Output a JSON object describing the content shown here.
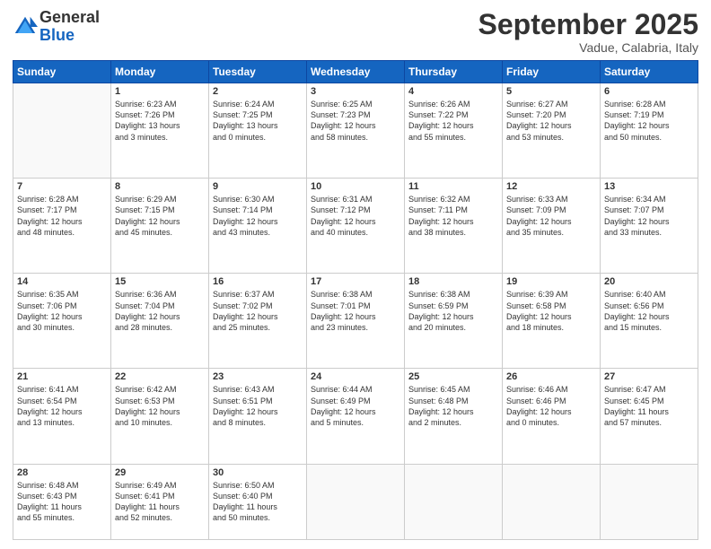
{
  "logo": {
    "general": "General",
    "blue": "Blue"
  },
  "header": {
    "month": "September 2025",
    "location": "Vadue, Calabria, Italy"
  },
  "weekdays": [
    "Sunday",
    "Monday",
    "Tuesday",
    "Wednesday",
    "Thursday",
    "Friday",
    "Saturday"
  ],
  "weeks": [
    [
      {
        "day": "",
        "info": ""
      },
      {
        "day": "1",
        "info": "Sunrise: 6:23 AM\nSunset: 7:26 PM\nDaylight: 13 hours\nand 3 minutes."
      },
      {
        "day": "2",
        "info": "Sunrise: 6:24 AM\nSunset: 7:25 PM\nDaylight: 13 hours\nand 0 minutes."
      },
      {
        "day": "3",
        "info": "Sunrise: 6:25 AM\nSunset: 7:23 PM\nDaylight: 12 hours\nand 58 minutes."
      },
      {
        "day": "4",
        "info": "Sunrise: 6:26 AM\nSunset: 7:22 PM\nDaylight: 12 hours\nand 55 minutes."
      },
      {
        "day": "5",
        "info": "Sunrise: 6:27 AM\nSunset: 7:20 PM\nDaylight: 12 hours\nand 53 minutes."
      },
      {
        "day": "6",
        "info": "Sunrise: 6:28 AM\nSunset: 7:19 PM\nDaylight: 12 hours\nand 50 minutes."
      }
    ],
    [
      {
        "day": "7",
        "info": "Sunrise: 6:28 AM\nSunset: 7:17 PM\nDaylight: 12 hours\nand 48 minutes."
      },
      {
        "day": "8",
        "info": "Sunrise: 6:29 AM\nSunset: 7:15 PM\nDaylight: 12 hours\nand 45 minutes."
      },
      {
        "day": "9",
        "info": "Sunrise: 6:30 AM\nSunset: 7:14 PM\nDaylight: 12 hours\nand 43 minutes."
      },
      {
        "day": "10",
        "info": "Sunrise: 6:31 AM\nSunset: 7:12 PM\nDaylight: 12 hours\nand 40 minutes."
      },
      {
        "day": "11",
        "info": "Sunrise: 6:32 AM\nSunset: 7:11 PM\nDaylight: 12 hours\nand 38 minutes."
      },
      {
        "day": "12",
        "info": "Sunrise: 6:33 AM\nSunset: 7:09 PM\nDaylight: 12 hours\nand 35 minutes."
      },
      {
        "day": "13",
        "info": "Sunrise: 6:34 AM\nSunset: 7:07 PM\nDaylight: 12 hours\nand 33 minutes."
      }
    ],
    [
      {
        "day": "14",
        "info": "Sunrise: 6:35 AM\nSunset: 7:06 PM\nDaylight: 12 hours\nand 30 minutes."
      },
      {
        "day": "15",
        "info": "Sunrise: 6:36 AM\nSunset: 7:04 PM\nDaylight: 12 hours\nand 28 minutes."
      },
      {
        "day": "16",
        "info": "Sunrise: 6:37 AM\nSunset: 7:02 PM\nDaylight: 12 hours\nand 25 minutes."
      },
      {
        "day": "17",
        "info": "Sunrise: 6:38 AM\nSunset: 7:01 PM\nDaylight: 12 hours\nand 23 minutes."
      },
      {
        "day": "18",
        "info": "Sunrise: 6:38 AM\nSunset: 6:59 PM\nDaylight: 12 hours\nand 20 minutes."
      },
      {
        "day": "19",
        "info": "Sunrise: 6:39 AM\nSunset: 6:58 PM\nDaylight: 12 hours\nand 18 minutes."
      },
      {
        "day": "20",
        "info": "Sunrise: 6:40 AM\nSunset: 6:56 PM\nDaylight: 12 hours\nand 15 minutes."
      }
    ],
    [
      {
        "day": "21",
        "info": "Sunrise: 6:41 AM\nSunset: 6:54 PM\nDaylight: 12 hours\nand 13 minutes."
      },
      {
        "day": "22",
        "info": "Sunrise: 6:42 AM\nSunset: 6:53 PM\nDaylight: 12 hours\nand 10 minutes."
      },
      {
        "day": "23",
        "info": "Sunrise: 6:43 AM\nSunset: 6:51 PM\nDaylight: 12 hours\nand 8 minutes."
      },
      {
        "day": "24",
        "info": "Sunrise: 6:44 AM\nSunset: 6:49 PM\nDaylight: 12 hours\nand 5 minutes."
      },
      {
        "day": "25",
        "info": "Sunrise: 6:45 AM\nSunset: 6:48 PM\nDaylight: 12 hours\nand 2 minutes."
      },
      {
        "day": "26",
        "info": "Sunrise: 6:46 AM\nSunset: 6:46 PM\nDaylight: 12 hours\nand 0 minutes."
      },
      {
        "day": "27",
        "info": "Sunrise: 6:47 AM\nSunset: 6:45 PM\nDaylight: 11 hours\nand 57 minutes."
      }
    ],
    [
      {
        "day": "28",
        "info": "Sunrise: 6:48 AM\nSunset: 6:43 PM\nDaylight: 11 hours\nand 55 minutes."
      },
      {
        "day": "29",
        "info": "Sunrise: 6:49 AM\nSunset: 6:41 PM\nDaylight: 11 hours\nand 52 minutes."
      },
      {
        "day": "30",
        "info": "Sunrise: 6:50 AM\nSunset: 6:40 PM\nDaylight: 11 hours\nand 50 minutes."
      },
      {
        "day": "",
        "info": ""
      },
      {
        "day": "",
        "info": ""
      },
      {
        "day": "",
        "info": ""
      },
      {
        "day": "",
        "info": ""
      }
    ]
  ]
}
